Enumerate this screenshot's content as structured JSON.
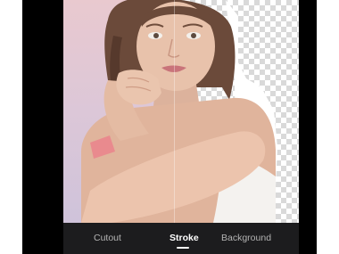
{
  "editor": {
    "mode": "stroke",
    "background_left": "pastel-pink-gradient",
    "background_right": "transparency-checkerboard",
    "stroke_color": "#ffffff"
  },
  "tabs": [
    {
      "label": "Cutout",
      "active": false
    },
    {
      "label": "Stroke",
      "active": true
    },
    {
      "label": "Background",
      "active": false
    }
  ],
  "colors": {
    "bar_bg": "#1c1c1e",
    "tab_inactive": "#b3b3b3",
    "tab_active": "#ffffff"
  }
}
